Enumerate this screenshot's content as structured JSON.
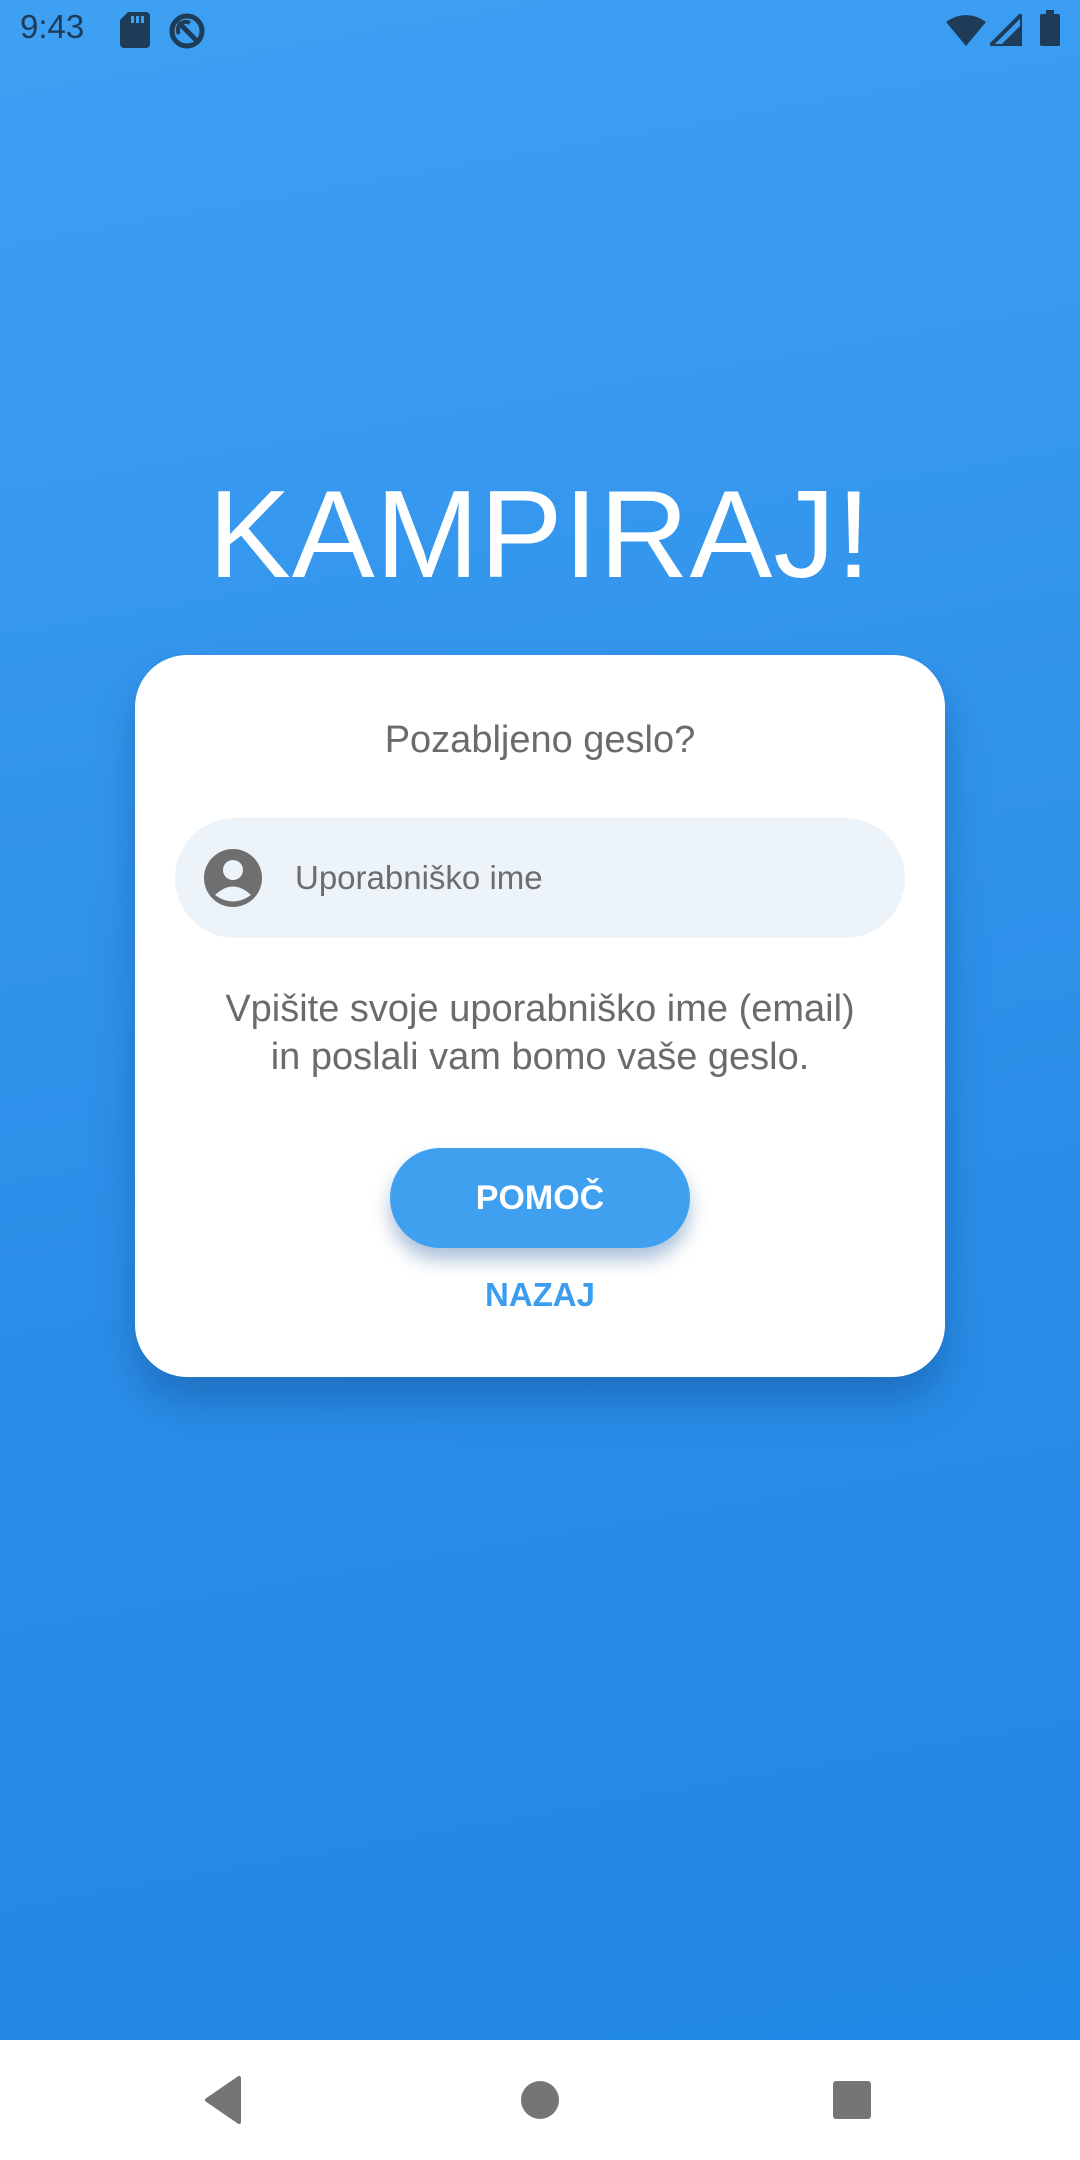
{
  "status_bar": {
    "time": "9:43",
    "left_icons": [
      "sd-card-icon",
      "sync-icon"
    ],
    "right_icons": [
      "wifi-icon",
      "signal-icon",
      "battery-icon"
    ]
  },
  "app": {
    "title": "KAMPIRAJ!"
  },
  "card": {
    "heading": "Pozabljeno geslo?",
    "username_field": {
      "icon": "account-circle-icon",
      "placeholder": "Uporabniško ime",
      "value": ""
    },
    "help_text_line1": "Vpišite svoje uporabniško ime (email)",
    "help_text_line2": "in poslali vam bomo vaše geslo.",
    "primary_button_label": "POMOČ",
    "back_button_label": "NAZAJ"
  },
  "nav_bar": {
    "buttons": [
      "back-icon",
      "home-icon",
      "recents-icon"
    ]
  },
  "colors": {
    "background": "#2b8ee8",
    "accent": "#3fa0f0",
    "card": "#ffffff",
    "input_background": "#ecf3f9"
  }
}
